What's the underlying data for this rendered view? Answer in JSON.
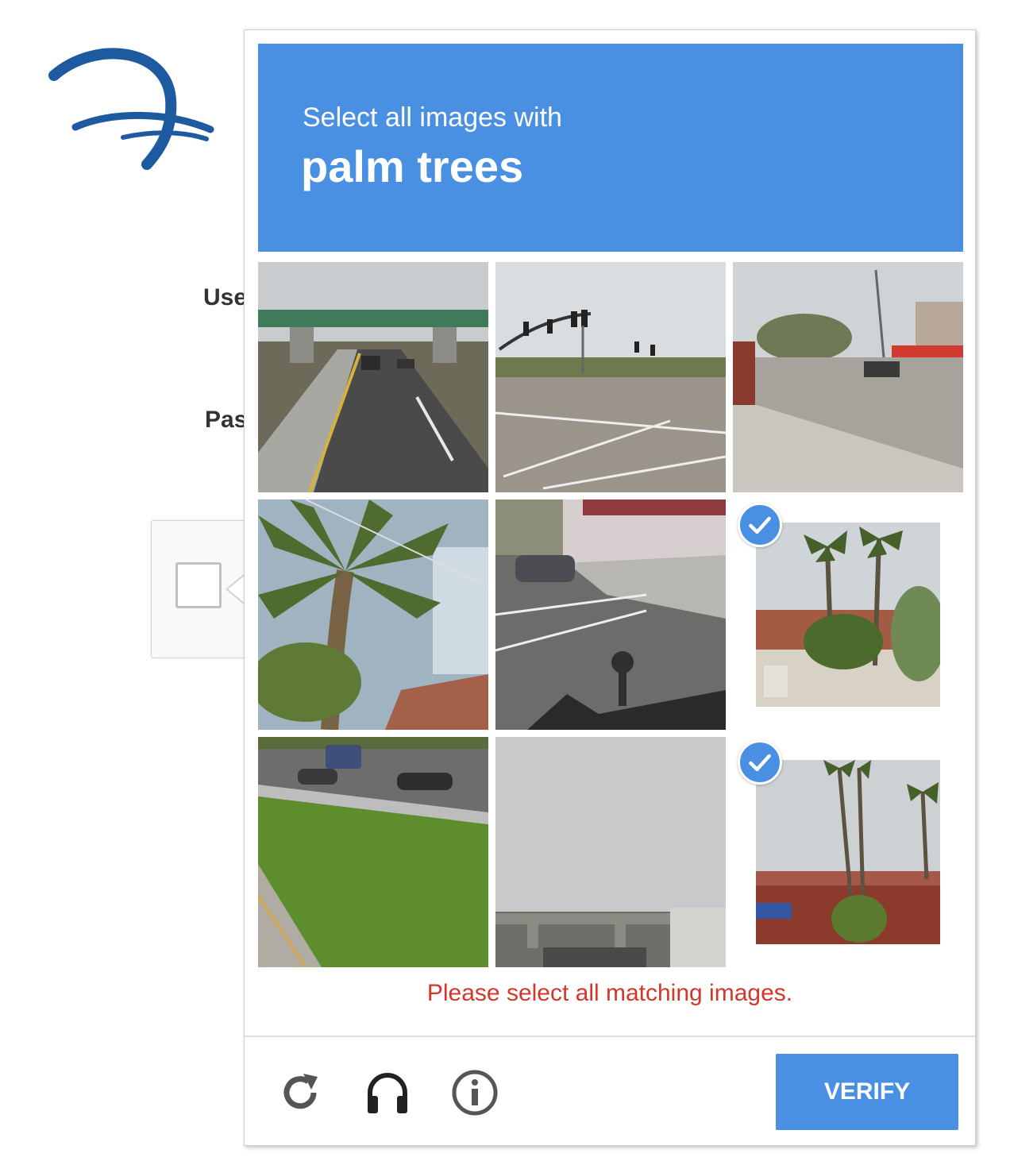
{
  "background": {
    "username_label_partial": "Use",
    "password_label_partial": "Pas"
  },
  "challenge": {
    "prompt_line1": "Select all images with",
    "prompt_target": "palm trees",
    "error_message": "Please select all matching images.",
    "verify_label": "VERIFY",
    "accent_color": "#4a90e2",
    "error_color": "#d1382b",
    "tiles": [
      {
        "name": "tile-highway-overpass",
        "selected": false
      },
      {
        "name": "tile-traffic-lights-intersection",
        "selected": false
      },
      {
        "name": "tile-gas-station-street",
        "selected": false
      },
      {
        "name": "tile-palm-tree-closeup",
        "selected": false
      },
      {
        "name": "tile-street-crosswalk",
        "selected": false
      },
      {
        "name": "tile-palm-trees-building",
        "selected": true
      },
      {
        "name": "tile-highway-grass",
        "selected": false
      },
      {
        "name": "tile-cloudy-sky-overpass",
        "selected": false
      },
      {
        "name": "tile-palm-trees-storefront",
        "selected": true
      }
    ],
    "footer_icons": [
      "reload-icon",
      "audio-headphones-icon",
      "info-icon"
    ]
  }
}
